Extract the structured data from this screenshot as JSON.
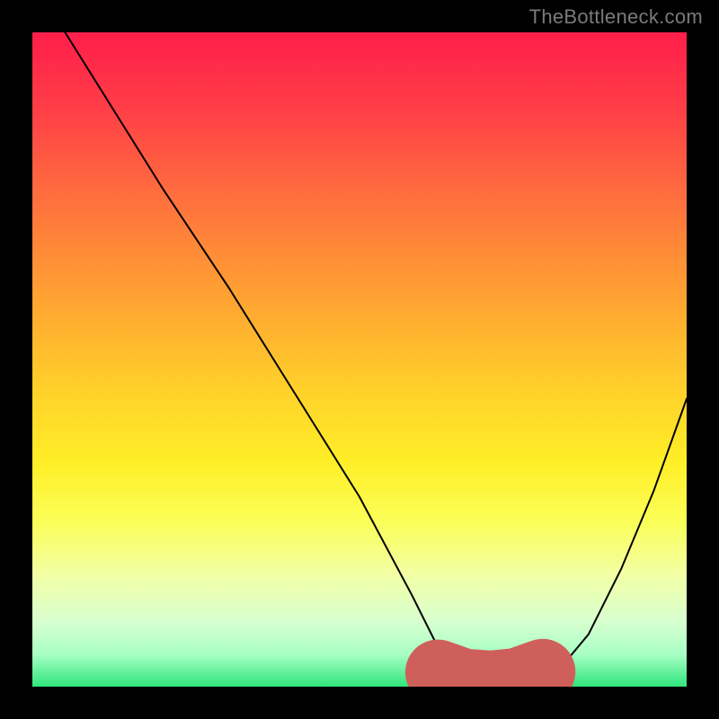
{
  "watermark": "TheBottleneck.com",
  "chart_data": {
    "type": "line",
    "title": "",
    "xlabel": "",
    "ylabel": "",
    "xlim": [
      0,
      100
    ],
    "ylim": [
      0,
      100
    ],
    "grid": false,
    "series": [
      {
        "name": "v-curve",
        "color": "#000000",
        "x": [
          5,
          10,
          20,
          30,
          40,
          50,
          58,
          62,
          66,
          70,
          74,
          80,
          85,
          90,
          95,
          100
        ],
        "y": [
          100,
          92,
          76,
          61,
          45,
          29,
          14,
          6,
          2,
          0.5,
          0.5,
          2,
          8,
          18,
          30,
          44
        ]
      },
      {
        "name": "flat-marker",
        "color": "#cf5f5b",
        "x": [
          62,
          66,
          70,
          74,
          78
        ],
        "y": [
          2.2,
          0.8,
          0.5,
          0.9,
          2.3
        ]
      }
    ],
    "background_gradient": {
      "top": "#ff1e4a",
      "mid_top": "#ffa133",
      "mid": "#ffef28",
      "mid_bottom": "#d8ffcf",
      "bottom": "#2fe67d"
    }
  }
}
